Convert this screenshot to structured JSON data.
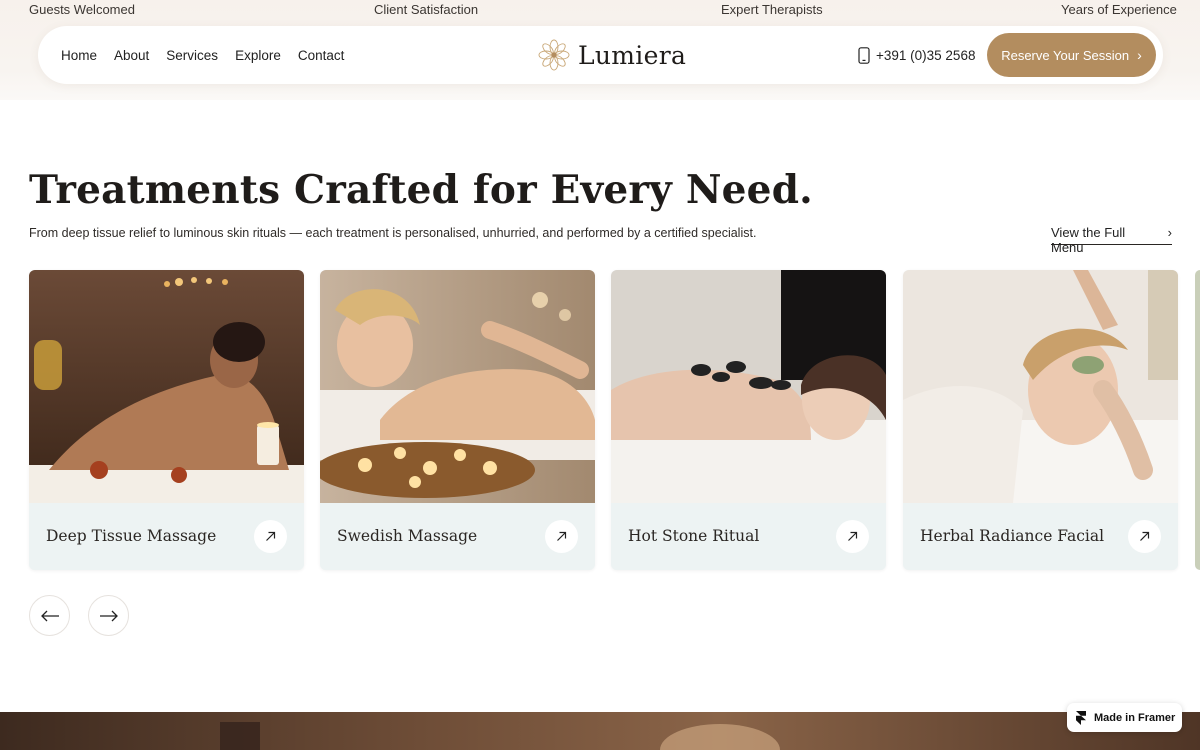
{
  "stats": [
    "Guests Welcomed",
    "Client Satisfaction",
    "Expert Therapists",
    "Years of Experience"
  ],
  "nav": {
    "links": [
      "Home",
      "About",
      "Services",
      "Explore",
      "Contact"
    ],
    "brand": "Lumiera",
    "phone": "+391 (0)35 2568",
    "cta": "Reserve Your Session"
  },
  "section": {
    "title": "Treatments Crafted for Every Need.",
    "subtitle": "From deep tissue relief to luminous skin rituals — each treatment is personalised, unhurried, and performed by a certified specialist.",
    "full_menu": "View the Full Menu"
  },
  "treatments": [
    {
      "title": "Deep Tissue Massage"
    },
    {
      "title": "Swedish Massage"
    },
    {
      "title": "Hot Stone Ritual"
    },
    {
      "title": "Herbal Radiance Facial"
    }
  ],
  "badge": "Made in Framer",
  "colors": {
    "accent": "#b38d5f",
    "card_footer": "#edf3f3",
    "top_band": "#f7f1ec",
    "text": "#2a2623"
  },
  "icons": {
    "brand": "flower-logo-icon",
    "phone": "phone-icon",
    "chevron": "chevron-right-icon",
    "card_arrow": "arrow-up-right-icon",
    "prev": "arrow-left-icon",
    "next": "arrow-right-icon",
    "framer": "framer-logo-icon"
  }
}
